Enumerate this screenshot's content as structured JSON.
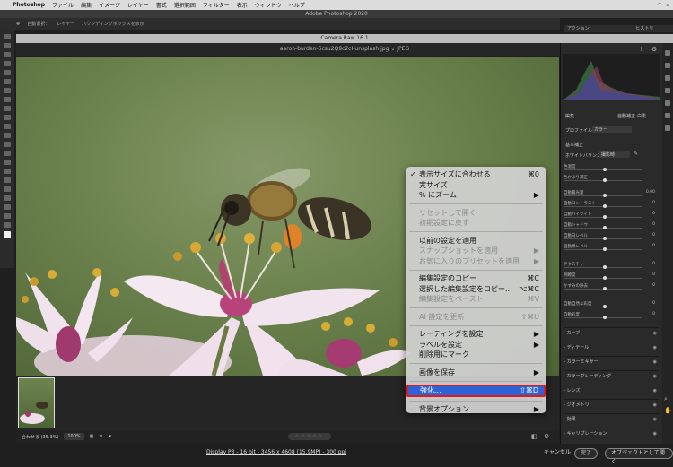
{
  "menubar": {
    "apple": "",
    "app": "Photoshop",
    "items": [
      "ファイル",
      "編集",
      "イメージ",
      "レイヤー",
      "書式",
      "選択範囲",
      "フィルター",
      "表示",
      "ウィンドウ",
      "ヘルプ"
    ]
  },
  "window_title": "Adobe Photoshop 2020",
  "options_bar": {
    "auto_select": "自動選択：",
    "layer": "レイヤー",
    "bbox": "バウンディングボックスを表示"
  },
  "actions_panel": {
    "tab": "アクション",
    "history": "ヒストリー"
  },
  "camera_raw": {
    "title": "Camera Raw 16.1",
    "filename": "aaron-burden-6csu2Q9c2cI-unsplash.jpg",
    "format": "JPEG"
  },
  "bottom_bar": {
    "fit": "合わせる (35.3%)",
    "zoom": "100%",
    "stars": "☆☆☆☆☆"
  },
  "info_link": "Display P3 - 16 bit - 3456 x 4608 (15.9MP) - 300 ppi",
  "buttons": {
    "cancel": "キャンセル",
    "done": "完了",
    "open": "オブジェクトとして開く"
  },
  "right_panel": {
    "edit": "編集",
    "auto": "自動補正",
    "bw": "白黒",
    "profile_label": "プロファイル",
    "profile_value": "カラー",
    "basic": "基本補正",
    "wb_label": "ホワイトバランス",
    "wb_value": "撮影時",
    "sliders": [
      {
        "label": "色温度",
        "value": ""
      },
      {
        "label": "色かぶり補正",
        "value": ""
      },
      {
        "label": "自動露光量",
        "value": "0.00"
      },
      {
        "label": "自動コントラスト",
        "value": "0"
      },
      {
        "label": "自動ハイライト",
        "value": "0"
      },
      {
        "label": "自動シャドウ",
        "value": "0"
      },
      {
        "label": "自動白レベル",
        "value": "0"
      },
      {
        "label": "自動黒レベル",
        "value": "0"
      },
      {
        "label": "テクスチャ",
        "value": "0"
      },
      {
        "label": "明瞭度",
        "value": "0"
      },
      {
        "label": "かすみの除去",
        "value": "0"
      },
      {
        "label": "自動自然な彩度",
        "value": "0"
      },
      {
        "label": "自動彩度",
        "value": "0"
      }
    ],
    "sections": [
      "カーブ",
      "ディテール",
      "カラーミキサー",
      "カラーグレーディング",
      "レンズ",
      "ジオメトリ",
      "効果",
      "キャリブレーション"
    ]
  },
  "context_menu": {
    "items": [
      {
        "label": "表示サイズに合わせる",
        "shortcut": "⌘0",
        "checked": true
      },
      {
        "label": "実サイズ",
        "shortcut": ""
      },
      {
        "label": "% にズーム",
        "shortcut": "▶"
      },
      {
        "sep": true
      },
      {
        "label": "リセットして開く",
        "shortcut": "",
        "disabled": true
      },
      {
        "label": "初期設定に戻す",
        "shortcut": "",
        "disabled": true
      },
      {
        "sep": true
      },
      {
        "label": "以前の設定を適用",
        "shortcut": ""
      },
      {
        "label": "スナップショットを適用",
        "shortcut": "▶",
        "disabled": true
      },
      {
        "label": "お気に入りのプリセットを適用",
        "shortcut": "▶",
        "disabled": true
      },
      {
        "sep": true
      },
      {
        "label": "編集設定のコピー",
        "shortcut": "⌘C"
      },
      {
        "label": "選択した編集設定をコピー...",
        "shortcut": "⌥⌘C"
      },
      {
        "label": "編集設定をペースト",
        "shortcut": "⌘V",
        "disabled": true
      },
      {
        "sep": true
      },
      {
        "label": "AI 設定を更新",
        "shortcut": "⇧⌘U",
        "disabled": true
      },
      {
        "sep": true
      },
      {
        "label": "レーティングを設定",
        "shortcut": "▶"
      },
      {
        "label": "ラベルを設定",
        "shortcut": "▶"
      },
      {
        "label": "削除用にマーク",
        "shortcut": ""
      },
      {
        "sep": true
      },
      {
        "label": "画像を保存",
        "shortcut": "▶"
      },
      {
        "sep": true
      },
      {
        "label": "強化...",
        "shortcut": "⇧⌘D",
        "highlighted": true
      },
      {
        "sep": true
      },
      {
        "label": "背景オプション",
        "shortcut": "▶"
      }
    ]
  }
}
